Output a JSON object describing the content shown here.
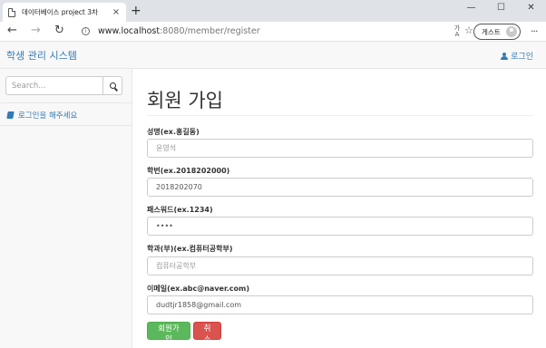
{
  "browser": {
    "tab_title": "데이터베이스 project 3차",
    "tab_close": "×",
    "new_tab": "+",
    "window_controls": [
      "—",
      "☐",
      "✕"
    ],
    "url_host": "www.localhost",
    "url_rest": ":8080/member/register",
    "profile_label": "게스트",
    "icons": [
      "page-icon",
      "back-icon",
      "forward-icon",
      "reload-icon",
      "info-icon",
      "translate-icon",
      "star-icon",
      "avatar-icon",
      "more-icon"
    ]
  },
  "navbar": {
    "brand": "학생 관리 시스템",
    "login_label": "로그인"
  },
  "sidebar": {
    "search_placeholder": "Search...",
    "login_prompt": "로그인을 해주세요"
  },
  "form": {
    "title": "회원 가입",
    "fields": [
      {
        "label": "성명(ex.홍길동)",
        "value": "",
        "placeholder": "윤영석"
      },
      {
        "label": "학번(ex.2018202000)",
        "value": "2018202070",
        "placeholder": ""
      },
      {
        "label": "패스워드(ex.1234)",
        "value": "••••",
        "placeholder": ""
      },
      {
        "label": "학과(부)(ex.컴퓨터공학부)",
        "value": "",
        "placeholder": "컴퓨터공학부"
      },
      {
        "label": "이메일(ex.abc@naver.com)",
        "value": "dudtjr1858@gmail.com",
        "placeholder": ""
      }
    ],
    "submit_label": "회원가입",
    "cancel_label": "취소"
  },
  "colors": {
    "link": "#337ab7",
    "success": "#5cb85c",
    "danger": "#d9534f"
  }
}
